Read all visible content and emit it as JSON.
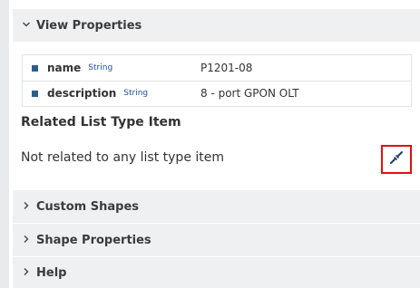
{
  "sections": {
    "view_properties": {
      "label": "View Properties",
      "expanded": true
    },
    "custom_shapes": {
      "label": "Custom Shapes",
      "expanded": false
    },
    "shape_properties": {
      "label": "Shape Properties",
      "expanded": false
    },
    "help": {
      "label": "Help",
      "expanded": false
    }
  },
  "properties": [
    {
      "name": "name",
      "type": "String",
      "value": "P1201-08"
    },
    {
      "name": "description",
      "type": "String",
      "value": "8 - port GPON OLT"
    }
  ],
  "related": {
    "title": "Related List Type Item",
    "text": "Not related to any list type item"
  },
  "icons": {
    "expanded": "chevron-down-icon",
    "collapsed": "chevron-right-icon",
    "link": "link-icon"
  },
  "colors": {
    "header_bg": "#eef0f2",
    "type_label": "#1a4fa0",
    "bullet": "#2b5f8a",
    "highlight": "#e01010"
  }
}
